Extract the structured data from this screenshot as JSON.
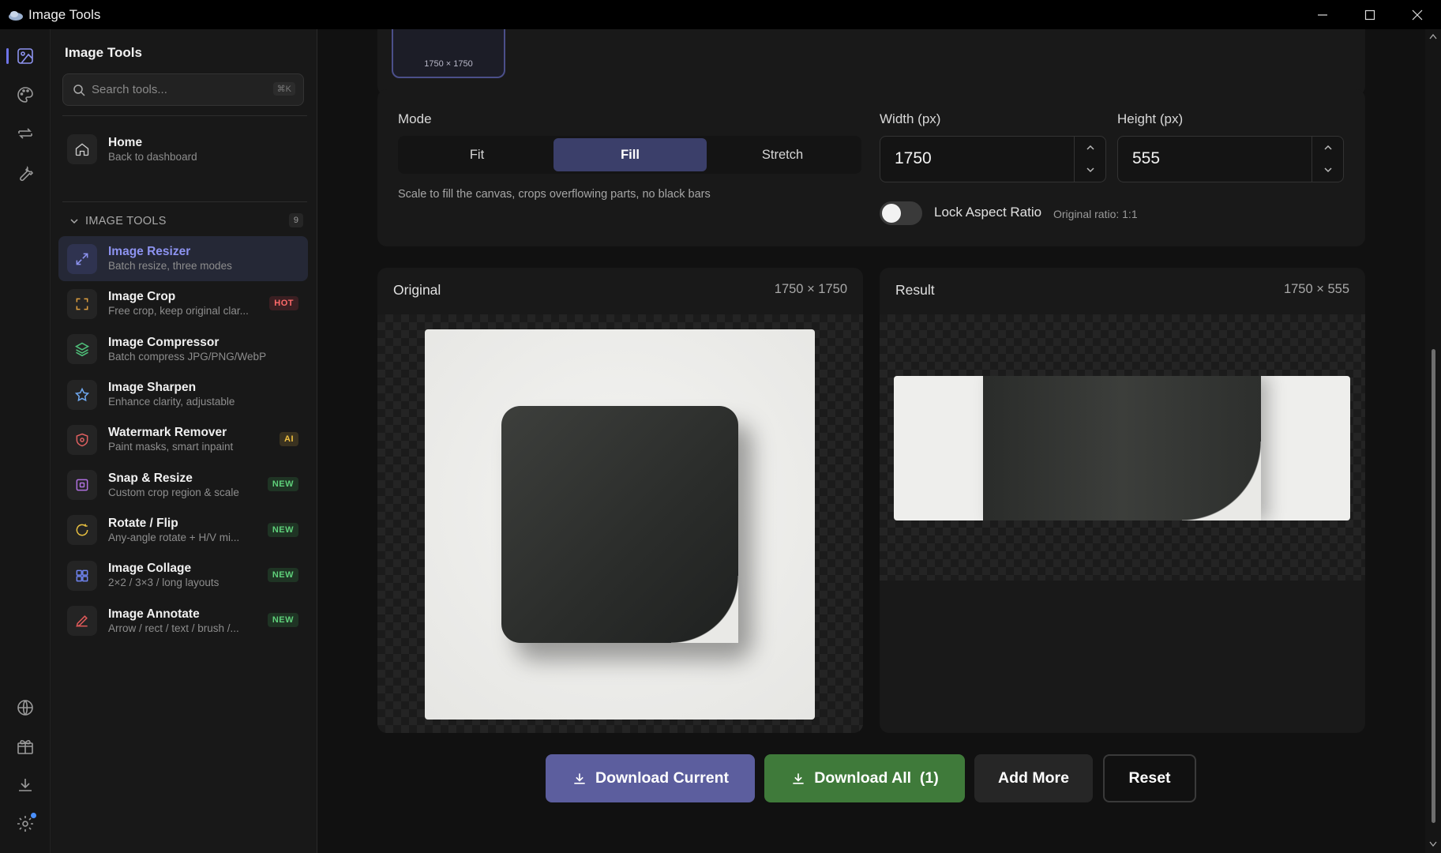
{
  "window": {
    "title": "Image Tools"
  },
  "sidebar": {
    "title": "Image Tools",
    "search_placeholder": "Search tools...",
    "search_shortcut": "⌘K",
    "home": {
      "title": "Home",
      "subtitle": "Back to dashboard"
    },
    "section": {
      "label": "IMAGE TOOLS",
      "count": "9"
    },
    "tools": [
      {
        "title": "Image Resizer",
        "subtitle": "Batch resize, three modes",
        "badge": "",
        "icon": "resize-icon",
        "color": "#8d93f0"
      },
      {
        "title": "Image Crop",
        "subtitle": "Free crop, keep original clar...",
        "badge": "HOT",
        "icon": "crop-icon",
        "color": "#e0a040"
      },
      {
        "title": "Image Compressor",
        "subtitle": "Batch compress JPG/PNG/WebP",
        "badge": "",
        "icon": "layers-icon",
        "color": "#4fc07a"
      },
      {
        "title": "Image Sharpen",
        "subtitle": "Enhance clarity, adjustable",
        "badge": "",
        "icon": "star-icon",
        "color": "#6fa8f0"
      },
      {
        "title": "Watermark Remover",
        "subtitle": "Paint masks, smart inpaint",
        "badge": "AI",
        "icon": "shield-icon",
        "color": "#e06060"
      },
      {
        "title": "Snap & Resize",
        "subtitle": "Custom crop region & scale",
        "badge": "NEW",
        "icon": "snap-icon",
        "color": "#b070e0"
      },
      {
        "title": "Rotate / Flip",
        "subtitle": "Any-angle rotate + H/V mi...",
        "badge": "NEW",
        "icon": "rotate-icon",
        "color": "#e8c040"
      },
      {
        "title": "Image Collage",
        "subtitle": "2×2 / 3×3 / long layouts",
        "badge": "NEW",
        "icon": "grid-icon",
        "color": "#6f84f0"
      },
      {
        "title": "Image Annotate",
        "subtitle": "Arrow / rect / text / brush /...",
        "badge": "NEW",
        "icon": "pen-icon",
        "color": "#e05a5a"
      }
    ]
  },
  "top_thumb": {
    "caption": "1750 × 1750"
  },
  "settings": {
    "mode_label": "Mode",
    "modes": [
      "Fit",
      "Fill",
      "Stretch"
    ],
    "selected_mode": "Fill",
    "mode_description": "Scale to fill the canvas, crops overflowing parts, no black bars",
    "width_label": "Width (px)",
    "width_value": "1750",
    "height_label": "Height (px)",
    "height_value": "555",
    "lock_label": "Lock Aspect Ratio",
    "lock_enabled": false,
    "ratio_text": "Original ratio: 1:1"
  },
  "preview": {
    "original": {
      "label": "Original",
      "dims": "1750 × 1750"
    },
    "result": {
      "label": "Result",
      "dims": "1750 × 555"
    }
  },
  "actions": {
    "download_current": "Download Current",
    "download_all": "Download All  (1)",
    "add_more": "Add More",
    "reset": "Reset"
  },
  "colors": {
    "accent": "#5c5e9e",
    "success": "#3f7a3a"
  }
}
